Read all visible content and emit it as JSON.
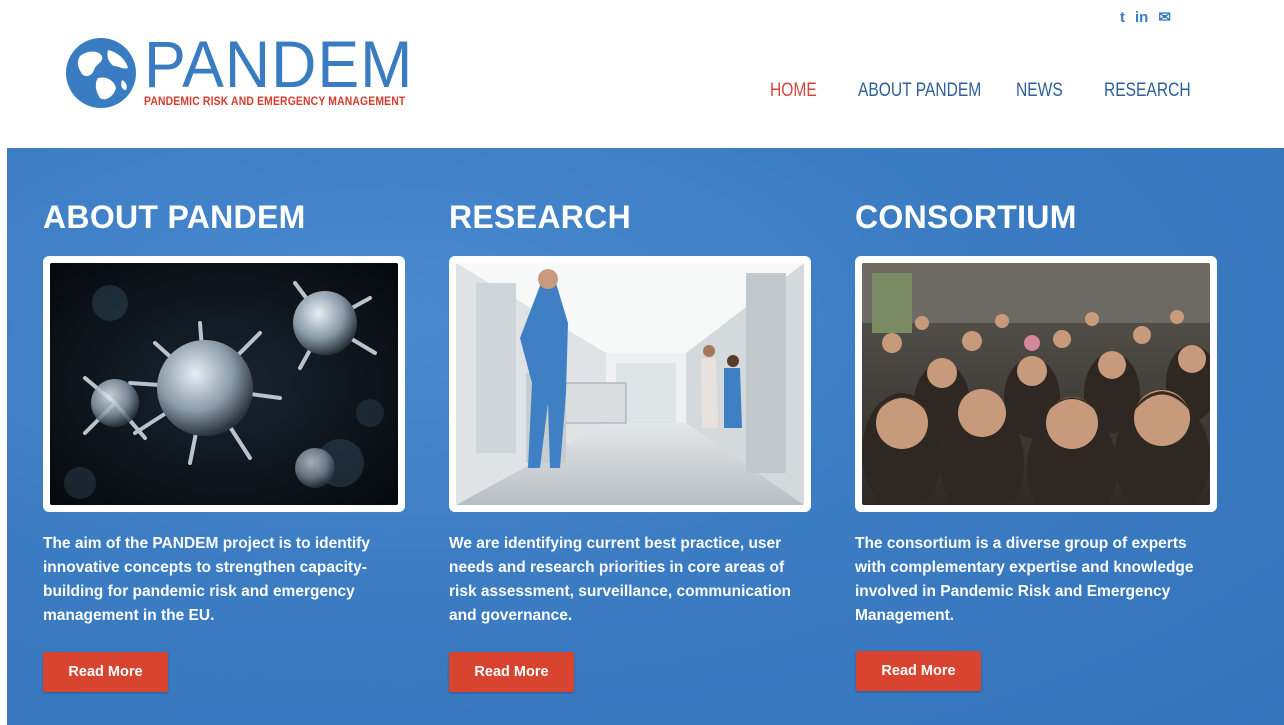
{
  "brand": {
    "name": "PANDEM",
    "tagline": "PANDEMIC RISK AND EMERGENCY MANAGEMENT",
    "primary_color": "#3a7cc2",
    "accent_color": "#d83a2c"
  },
  "social": [
    {
      "icon": "twitter-icon",
      "glyph": "t"
    },
    {
      "icon": "linkedin-icon",
      "glyph": "in"
    },
    {
      "icon": "email-icon",
      "glyph": "✉"
    }
  ],
  "nav": {
    "items": [
      "HOME",
      "ABOUT PANDEM",
      "NEWS",
      "RESEARCH"
    ],
    "active": "HOME"
  },
  "sections": [
    {
      "title": "ABOUT PANDEM",
      "image": "virus-image",
      "text": "The aim of the PANDEM project is to identify innovative concepts to strengthen capacity-building for pandemic risk and emergency management in the EU.",
      "button": "Read More"
    },
    {
      "title": "RESEARCH",
      "image": "hospital-corridor-image",
      "text": "We are identifying current best practice, user needs and research priorities in core areas of risk assessment, surveillance, communication and governance.",
      "button": "Read More"
    },
    {
      "title": "CONSORTIUM",
      "image": "crowd-image",
      "text": "The consortium is a diverse group of experts with complementary expertise and knowledge involved in Pandemic Risk and Emergency Management.",
      "button": "Read More"
    }
  ]
}
